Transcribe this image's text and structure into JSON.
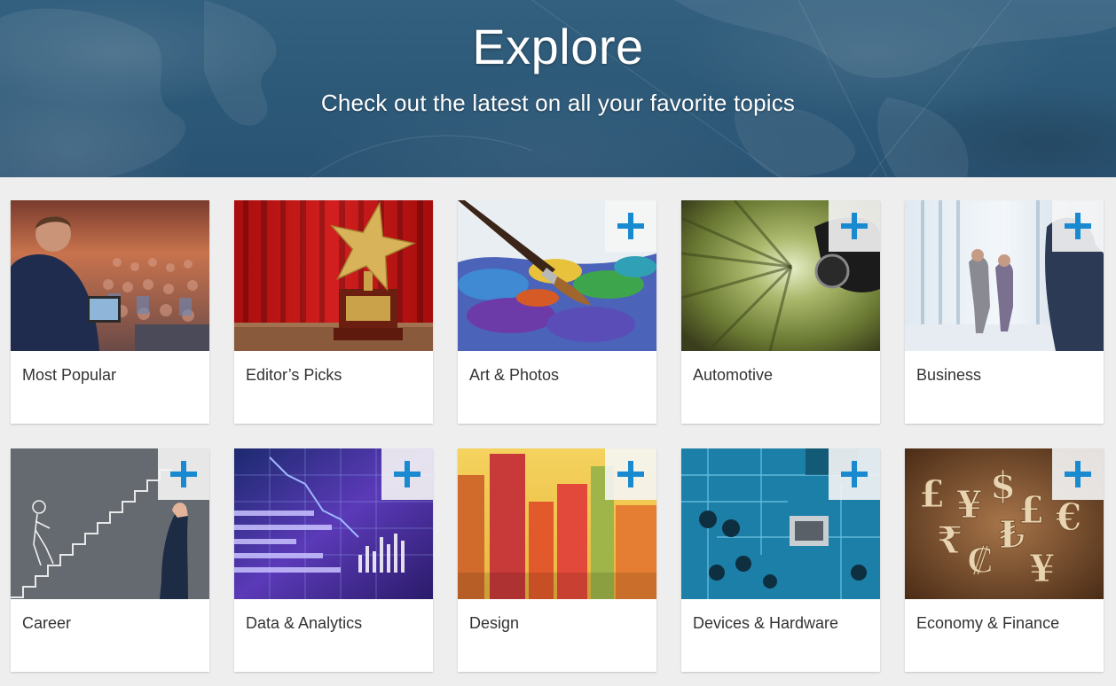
{
  "hero": {
    "title": "Explore",
    "subtitle": "Check out the latest on all your favorite topics"
  },
  "topics": [
    {
      "label": "Most Popular",
      "image": "conference-speaker-photo",
      "followable": false
    },
    {
      "label": "Editor’s Picks",
      "image": "gold-star-trophy-photo",
      "followable": false
    },
    {
      "label": "Art & Photos",
      "image": "paintbrush-palette-photo",
      "followable": true
    },
    {
      "label": "Automotive",
      "image": "speeding-car-photo",
      "followable": true
    },
    {
      "label": "Business",
      "image": "office-people-walking-photo",
      "followable": true
    },
    {
      "label": "Career",
      "image": "chalk-staircase-photo",
      "followable": true
    },
    {
      "label": "Data & Analytics",
      "image": "financial-data-chart-photo",
      "followable": true
    },
    {
      "label": "Design",
      "image": "colorful-bars-photo",
      "followable": true
    },
    {
      "label": "Devices & Hardware",
      "image": "circuit-board-photo",
      "followable": true
    },
    {
      "label": "Economy & Finance",
      "image": "currency-symbols-photo",
      "followable": true
    }
  ],
  "icons": {
    "add": "plus-icon"
  },
  "colors": {
    "hero_bg": "#2c5877",
    "accent": "#1a8ad0",
    "page_bg": "#eeeeee"
  }
}
